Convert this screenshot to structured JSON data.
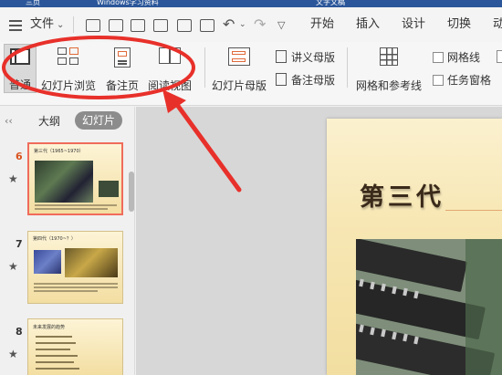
{
  "titlebar": {
    "tab1": "三页",
    "tab2": "Windows学习资料",
    "tab3": "文字文稿"
  },
  "menubar": {
    "file_label": "文件",
    "items": [
      "开始",
      "插入",
      "设计",
      "切换",
      "动画"
    ]
  },
  "ribbon": {
    "view_buttons": [
      "普通",
      "幻灯片浏览",
      "备注页",
      "阅读视图"
    ],
    "master_button": "幻灯片母版",
    "handout_master": "讲义母版",
    "notes_master": "备注母版",
    "grid_button": "网格和参考线",
    "gridline_check": "网格线",
    "taskpane_check": "任务窗格"
  },
  "sidebar": {
    "tab_outline": "大纲",
    "tab_slides": "幻灯片",
    "slides": [
      {
        "num": "6",
        "title": "第三代（1965~1970）"
      },
      {
        "num": "7",
        "title": "第四代（1970~？）"
      },
      {
        "num": "8",
        "title": "未来发展的趋势"
      }
    ]
  },
  "slide": {
    "title": "第三代"
  },
  "colors": {
    "accent": "#e8442f",
    "annotation": "#e8302a",
    "active_tab": "#8c8c8c"
  }
}
